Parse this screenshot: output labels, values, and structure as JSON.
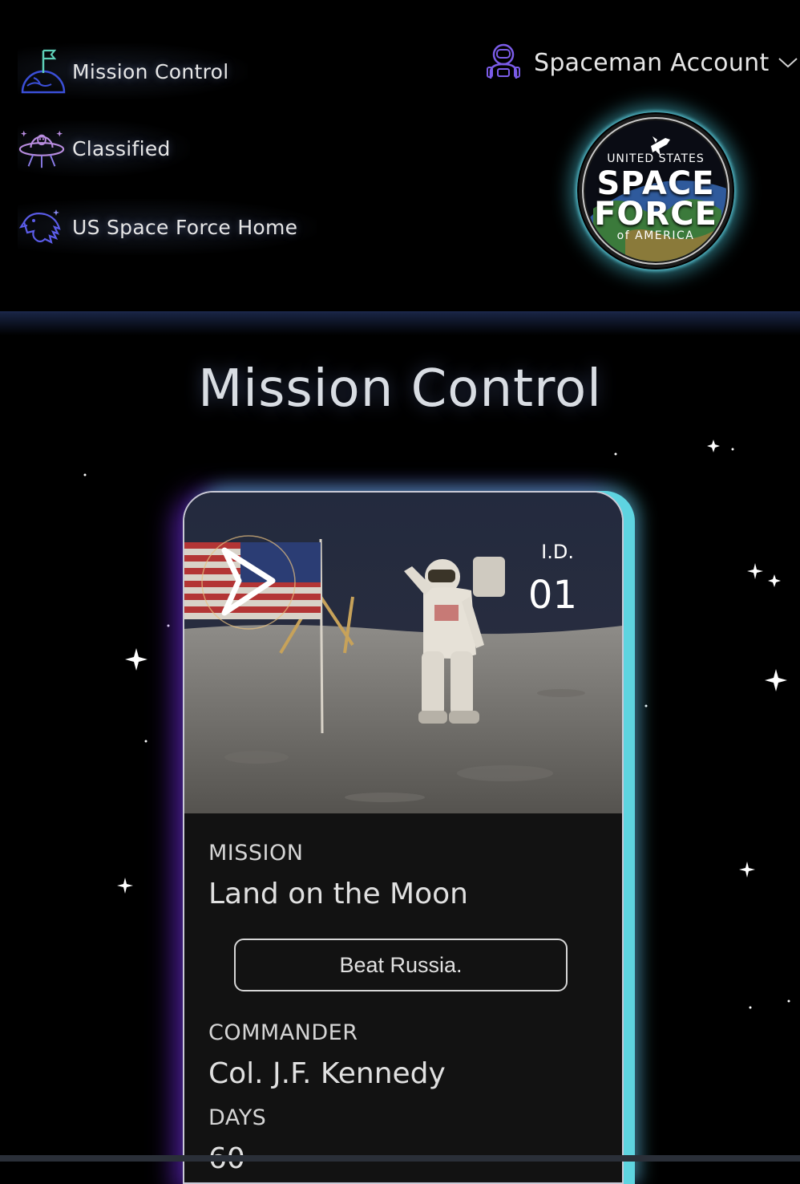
{
  "nav": {
    "items": [
      {
        "label": "Mission Control",
        "icon": "planet-flag-icon"
      },
      {
        "label": "Classified",
        "icon": "ufo-alien-icon"
      },
      {
        "label": "US Space Force Home",
        "icon": "eagle-icon"
      }
    ]
  },
  "account": {
    "label": "Spaceman Account",
    "icon": "astronaut-icon"
  },
  "logo": {
    "line1": "UNITED STATES",
    "line2": "SPACE",
    "line3": "FORCE",
    "line4": "of AMERICA"
  },
  "page": {
    "title": "Mission Control"
  },
  "card": {
    "id_label": "I.D.",
    "id_value": "01",
    "mission_label": "MISSION",
    "mission_value": "Land on the Moon",
    "objective_button": "Beat Russia.",
    "commander_label": "COMMANDER",
    "commander_value": "Col. J.F. Kennedy",
    "days_label": "DAYS",
    "days_value": "60"
  },
  "colors": {
    "accent_cyan": "#5ed4e0",
    "accent_purple": "#6024be",
    "background": "#000000"
  }
}
